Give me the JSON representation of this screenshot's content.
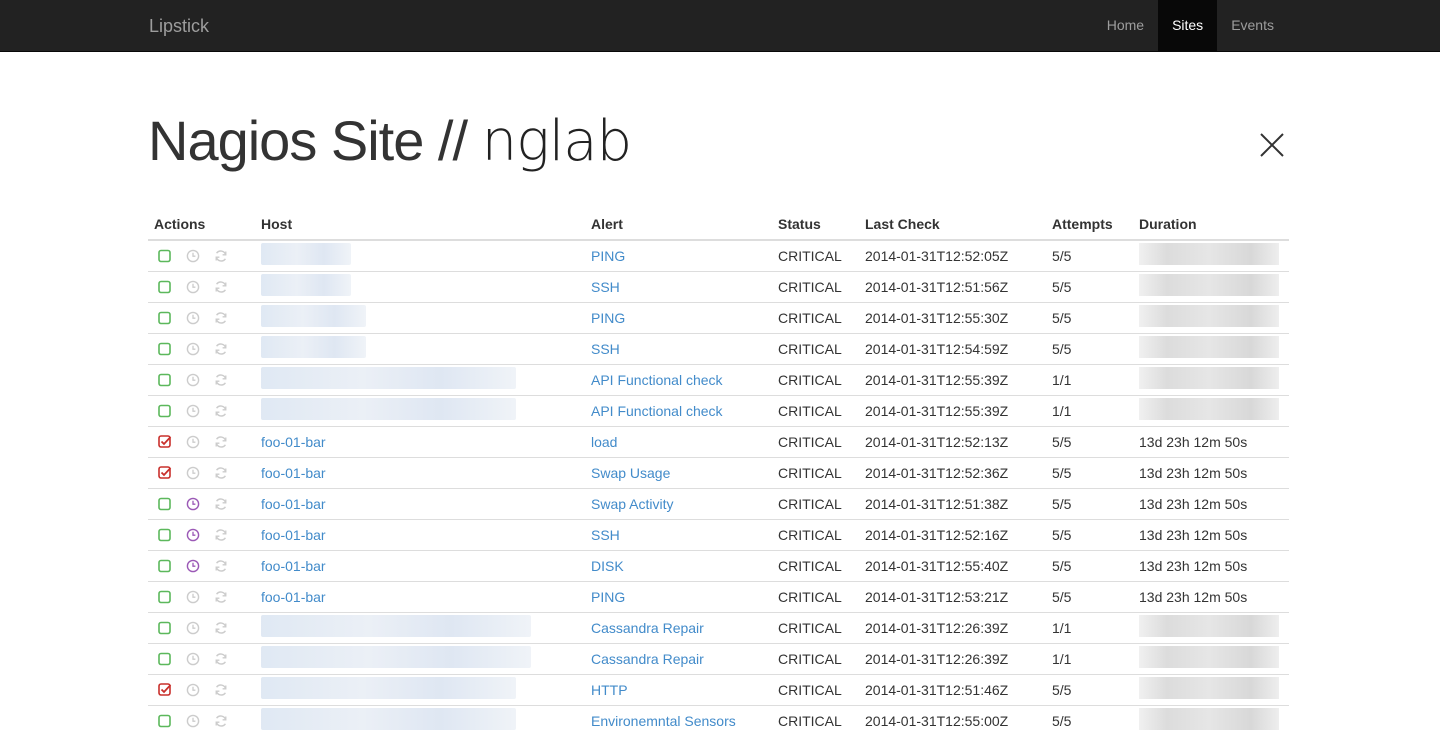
{
  "app": {
    "brand": "Lipstick"
  },
  "nav": [
    {
      "label": "Home",
      "active": false
    },
    {
      "label": "Sites",
      "active": true
    },
    {
      "label": "Events",
      "active": false
    }
  ],
  "page": {
    "title_prefix": "Nagios Site // ",
    "title_site": "nglab"
  },
  "table": {
    "headers": [
      "Actions",
      "Host",
      "Alert",
      "Status",
      "Last Check",
      "Attempts",
      "Duration"
    ],
    "rows": [
      {
        "ack": false,
        "scheduled": false,
        "host": "",
        "alert": "PING",
        "status": "CRITICAL",
        "last_check": "2014-01-31T12:52:05Z",
        "attempts": "5/5",
        "duration": ""
      },
      {
        "ack": false,
        "scheduled": false,
        "host": "",
        "alert": "SSH",
        "status": "CRITICAL",
        "last_check": "2014-01-31T12:51:56Z",
        "attempts": "5/5",
        "duration": ""
      },
      {
        "ack": false,
        "scheduled": false,
        "host": "",
        "alert": "PING",
        "status": "CRITICAL",
        "last_check": "2014-01-31T12:55:30Z",
        "attempts": "5/5",
        "duration": ""
      },
      {
        "ack": false,
        "scheduled": false,
        "host": "",
        "alert": "SSH",
        "status": "CRITICAL",
        "last_check": "2014-01-31T12:54:59Z",
        "attempts": "5/5",
        "duration": ""
      },
      {
        "ack": false,
        "scheduled": false,
        "host": "",
        "alert": "API Functional check",
        "status": "CRITICAL",
        "last_check": "2014-01-31T12:55:39Z",
        "attempts": "1/1",
        "duration": ""
      },
      {
        "ack": false,
        "scheduled": false,
        "host": "",
        "alert": "API Functional check",
        "status": "CRITICAL",
        "last_check": "2014-01-31T12:55:39Z",
        "attempts": "1/1",
        "duration": ""
      },
      {
        "ack": true,
        "scheduled": false,
        "host": "foo-01-bar",
        "alert": "load",
        "status": "CRITICAL",
        "last_check": "2014-01-31T12:52:13Z",
        "attempts": "5/5",
        "duration": "13d 23h 12m 50s"
      },
      {
        "ack": true,
        "scheduled": false,
        "host": "foo-01-bar",
        "alert": "Swap Usage",
        "status": "CRITICAL",
        "last_check": "2014-01-31T12:52:36Z",
        "attempts": "5/5",
        "duration": "13d 23h 12m 50s"
      },
      {
        "ack": false,
        "scheduled": true,
        "host": "foo-01-bar",
        "alert": "Swap Activity",
        "status": "CRITICAL",
        "last_check": "2014-01-31T12:51:38Z",
        "attempts": "5/5",
        "duration": "13d 23h 12m 50s"
      },
      {
        "ack": false,
        "scheduled": true,
        "host": "foo-01-bar",
        "alert": "SSH",
        "status": "CRITICAL",
        "last_check": "2014-01-31T12:52:16Z",
        "attempts": "5/5",
        "duration": "13d 23h 12m 50s"
      },
      {
        "ack": false,
        "scheduled": true,
        "host": "foo-01-bar",
        "alert": "DISK",
        "status": "CRITICAL",
        "last_check": "2014-01-31T12:55:40Z",
        "attempts": "5/5",
        "duration": "13d 23h 12m 50s"
      },
      {
        "ack": false,
        "scheduled": false,
        "host": "foo-01-bar",
        "alert": "PING",
        "status": "CRITICAL",
        "last_check": "2014-01-31T12:53:21Z",
        "attempts": "5/5",
        "duration": "13d 23h 12m 50s"
      },
      {
        "ack": false,
        "scheduled": false,
        "host": "",
        "alert": "Cassandra Repair",
        "status": "CRITICAL",
        "last_check": "2014-01-31T12:26:39Z",
        "attempts": "1/1",
        "duration": ""
      },
      {
        "ack": false,
        "scheduled": false,
        "host": "",
        "alert": "Cassandra Repair",
        "status": "CRITICAL",
        "last_check": "2014-01-31T12:26:39Z",
        "attempts": "1/1",
        "duration": ""
      },
      {
        "ack": true,
        "scheduled": false,
        "host": "",
        "alert": "HTTP",
        "status": "CRITICAL",
        "last_check": "2014-01-31T12:51:46Z",
        "attempts": "5/5",
        "duration": ""
      },
      {
        "ack": false,
        "scheduled": false,
        "host": "",
        "alert": "Environemntal Sensors",
        "status": "CRITICAL",
        "last_check": "2014-01-31T12:55:00Z",
        "attempts": "5/5",
        "duration": ""
      }
    ]
  },
  "colors": {
    "navbar_bg": "#222222",
    "link": "#428bca",
    "ok_green": "#5cb85c",
    "ack_red": "#c9302c",
    "scheduled_purple": "#9b59b6",
    "muted_icon": "#cccccc"
  },
  "icons": {
    "ack": "checkbox-icon",
    "schedule": "clock-icon",
    "recheck": "refresh-icon",
    "close": "close-icon"
  }
}
